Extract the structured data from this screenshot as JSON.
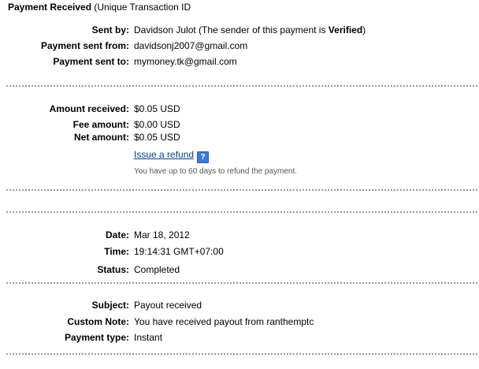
{
  "header": {
    "title_bold": "Payment Received",
    "title_rest": " (Unique Transaction ID"
  },
  "sender": {
    "sent_by_label": "Sent by:",
    "sent_by_name": "Davidson Julot",
    "sent_by_note_prefix": " (The sender of this payment is ",
    "sent_by_verified": "Verified",
    "sent_by_note_suffix": ")",
    "sent_from_label": "Payment sent from:",
    "sent_from_value": "davidsonj2007@gmail.com",
    "sent_to_label": "Payment sent to:",
    "sent_to_value": "mymoney.tk@gmail.com"
  },
  "amounts": {
    "received_label": "Amount received:",
    "received_value": "$0.05 USD",
    "fee_label": "Fee amount:",
    "fee_value": "$0.00 USD",
    "net_label": "Net amount:",
    "net_value": "$0.05 USD",
    "refund_link": "Issue a refund",
    "help_icon": "?",
    "refund_hint": "You have up to 60 days to refund the payment."
  },
  "details": {
    "date_label": "Date:",
    "date_value": "Mar 18, 2012",
    "time_label": "Time:",
    "time_value": "19:14:31 GMT+07:00",
    "status_label": "Status:",
    "status_value": "Completed"
  },
  "extra": {
    "subject_label": "Subject:",
    "subject_value": "Payout received",
    "note_label": "Custom Note:",
    "note_value": "You have received payout from ranthemptc",
    "type_label": "Payment type:",
    "type_value": "Instant"
  },
  "icons": {
    "help": "help-question-icon"
  },
  "colors": {
    "link": "#084482",
    "help_icon_bg": "#3a7bd5",
    "divider": "#9a9a9a"
  }
}
